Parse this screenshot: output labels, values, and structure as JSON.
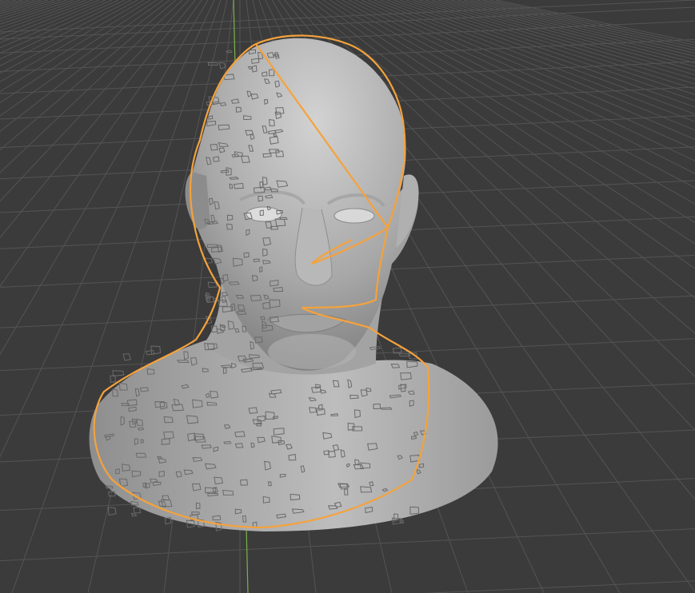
{
  "viewport": {
    "background": "#3b3b3b",
    "grid_line_color": "#545454",
    "y_axis_color": "#7ab34a",
    "selection_outline_color": "#f5a23c",
    "object": "sculpted-head-bust"
  }
}
